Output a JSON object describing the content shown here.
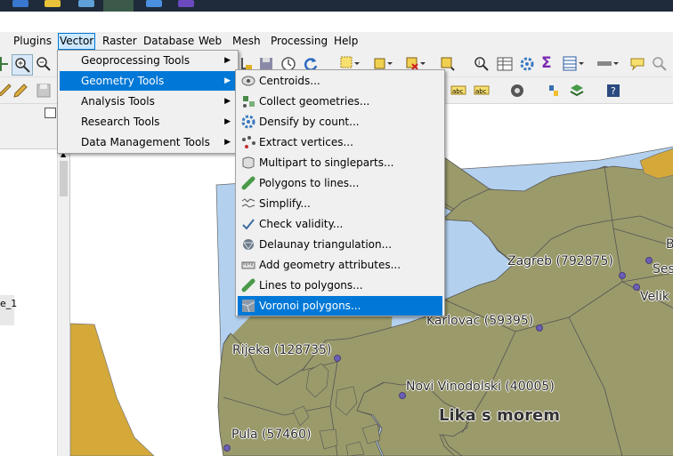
{
  "taskbar": {
    "icons": [
      "taskbar-app-icon-1",
      "taskbar-app-icon-2",
      "taskbar-app-icon-3",
      "taskbar-qgis-icon",
      "taskbar-app-icon-5",
      "taskbar-app-icon-6"
    ]
  },
  "menubar": {
    "items": [
      {
        "label": "Plugins"
      },
      {
        "label": "Vector"
      },
      {
        "label": "Raster"
      },
      {
        "label": "Database"
      },
      {
        "label": "Web"
      },
      {
        "label": "Mesh"
      },
      {
        "label": "Processing"
      },
      {
        "label": "Help"
      }
    ]
  },
  "vector_menu": {
    "items": [
      {
        "label": "Geoprocessing Tools"
      },
      {
        "label": "Geometry Tools"
      },
      {
        "label": "Analysis Tools"
      },
      {
        "label": "Research Tools"
      },
      {
        "label": "Data Management Tools"
      }
    ],
    "submenu_arrow": "▶"
  },
  "geometry_menu": {
    "items": [
      {
        "label": "Centroids...",
        "icon": "centroids-icon"
      },
      {
        "label": "Collect geometries...",
        "icon": "collect-geometries-icon"
      },
      {
        "label": "Densify by count...",
        "icon": "densify-icon"
      },
      {
        "label": "Extract vertices...",
        "icon": "extract-vertices-icon"
      },
      {
        "label": "Multipart to singleparts...",
        "icon": "multipart-icon"
      },
      {
        "label": "Polygons to lines...",
        "icon": "polygons-to-lines-icon"
      },
      {
        "label": "Simplify...",
        "icon": "simplify-icon"
      },
      {
        "label": "Check validity...",
        "icon": "check-validity-icon"
      },
      {
        "label": "Delaunay triangulation...",
        "icon": "delaunay-icon"
      },
      {
        "label": "Add geometry attributes...",
        "icon": "add-geometry-attributes-icon"
      },
      {
        "label": "Lines to polygons...",
        "icon": "lines-to-polygons-icon"
      },
      {
        "label": "Voronoi polygons...",
        "icon": "voronoi-icon"
      }
    ]
  },
  "layer_panel": {
    "partial_layer_name": "e_1"
  },
  "map": {
    "labels": {
      "zagreb": "Zagreb (792875)",
      "karlovac": "Karlovac (59395)",
      "rijeka": "Rijeka (128735)",
      "novi": "Novi Vinodolski (40005)",
      "pula": "Pula (57460)",
      "lika": "Lika s morem",
      "b_partial": "B",
      "ses_partial": "Ses",
      "velika_partial": "Velik"
    }
  },
  "colors": {
    "land": "#9b9a6b",
    "water": "#b3d1ef",
    "outside": "#d4a93a",
    "highlight": "#0078d7",
    "point": "#6a5fb5"
  }
}
